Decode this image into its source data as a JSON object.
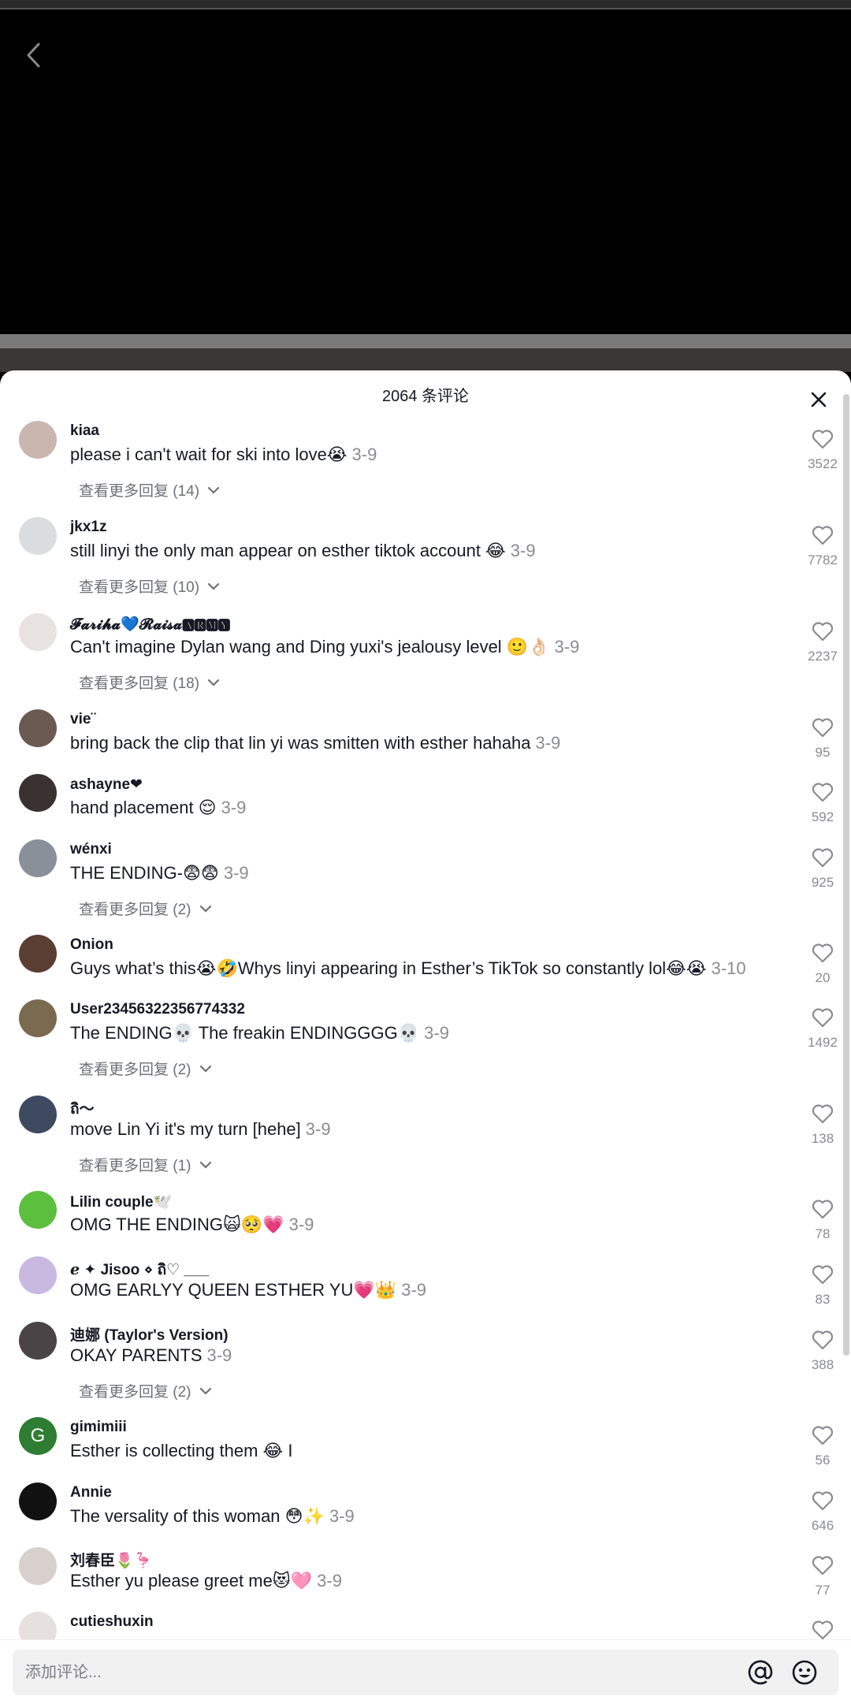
{
  "header": {
    "comment_count_title": "2064 条评论"
  },
  "input": {
    "placeholder": "添加评论..."
  },
  "comments": [
    {
      "user": "kiaa",
      "text": "please i can't wait for ski into love😭",
      "date": "3-9",
      "likes": "3522",
      "replies": "查看更多回复 (14)",
      "avatar_color": "#c9b6ae"
    },
    {
      "user": "jkx1z",
      "text": "still linyi the only man appear on esther tiktok account 😂",
      "date": "3-9",
      "likes": "7782",
      "replies": "查看更多回复 (10)",
      "avatar_color": "#d9dde0"
    },
    {
      "user": "𝓕𝓪𝓻𝓲𝓱𝓪💙𝓡𝓪𝓲𝓼𝓪🅰🆁🅼🆈",
      "text": "Can't imagine Dylan wang and Ding yuxi's jealousy level 🙂👌🏻",
      "date": "3-9",
      "likes": "2237",
      "replies": "查看更多回复 (18)",
      "avatar_color": "#e8e3e1"
    },
    {
      "user": "vie¨",
      "text": "bring back the clip that lin yi was smitten with esther hahaha",
      "date": "3-9",
      "likes": "95",
      "replies": "",
      "avatar_color": "#6b5a52"
    },
    {
      "user": "ashayne❤",
      "text": "hand placement 😌",
      "date": "3-9",
      "likes": "592",
      "replies": "",
      "avatar_color": "#3a3230"
    },
    {
      "user": "wénxi",
      "text": "THE ENDING-😨😨",
      "date": "3-9",
      "likes": "925",
      "replies": "查看更多回复 (2)",
      "avatar_color": "#8a9099"
    },
    {
      "user": "Onion",
      "text": "Guys what’s this😭🤣Whys linyi appearing in Esther’s TikTok so constantly lol😂😭",
      "date": "3-10",
      "likes": "20",
      "replies": "",
      "avatar_color": "#5a3d33"
    },
    {
      "user": "User23456322356774332",
      "text": "The ENDING💀 The freakin ENDINGGGG💀",
      "date": "3-9",
      "likes": "1492",
      "replies": "查看更多回复 (2)",
      "avatar_color": "#7a6a50"
    },
    {
      "user": "ถิ〜",
      "text": "move Lin Yi it's my turn [hehe]",
      "date": "3-9",
      "likes": "138",
      "replies": "查看更多回复 (1)",
      "avatar_color": "#3d4a60"
    },
    {
      "user": "Lilin couple🕊️",
      "text": "OMG THE ENDING🙀🥺💗",
      "date": "3-9",
      "likes": "78",
      "replies": "",
      "avatar_color": "#5cbf3e"
    },
    {
      "user": "ℯ ✦ Jisoo ⋄ ถิ♡ ___",
      "text": "OMG EARLYY QUEEN ESTHER YU💗👑",
      "date": "3-9",
      "likes": "83",
      "replies": "",
      "avatar_color": "#c9b9e0"
    },
    {
      "user": "迪娜 (Taylor's Version)",
      "text": "OKAY PARENTS",
      "date": "3-9",
      "likes": "388",
      "replies": "查看更多回复 (2)",
      "avatar_color": "#4a4446"
    },
    {
      "user": "gimimiii",
      "text": "Esther is collecting them 😂 I",
      "date": "",
      "likes": "56",
      "replies": "",
      "avatar_color": "#2e7d32",
      "avatar_letter": "G"
    },
    {
      "user": "Annie",
      "text": "The versality of this woman 😳✨",
      "date": "3-9",
      "likes": "646",
      "replies": "",
      "avatar_color": "#111111"
    },
    {
      "user": "刘春臣🌷🦩",
      "text": "Esther yu please greet me😻🩷",
      "date": "3-9",
      "likes": "77",
      "replies": "",
      "avatar_color": "#d8d0cc"
    },
    {
      "user": "cutieshuxin",
      "text": "",
      "date": "",
      "likes": "",
      "replies": "",
      "avatar_color": "#e6e0de"
    }
  ]
}
